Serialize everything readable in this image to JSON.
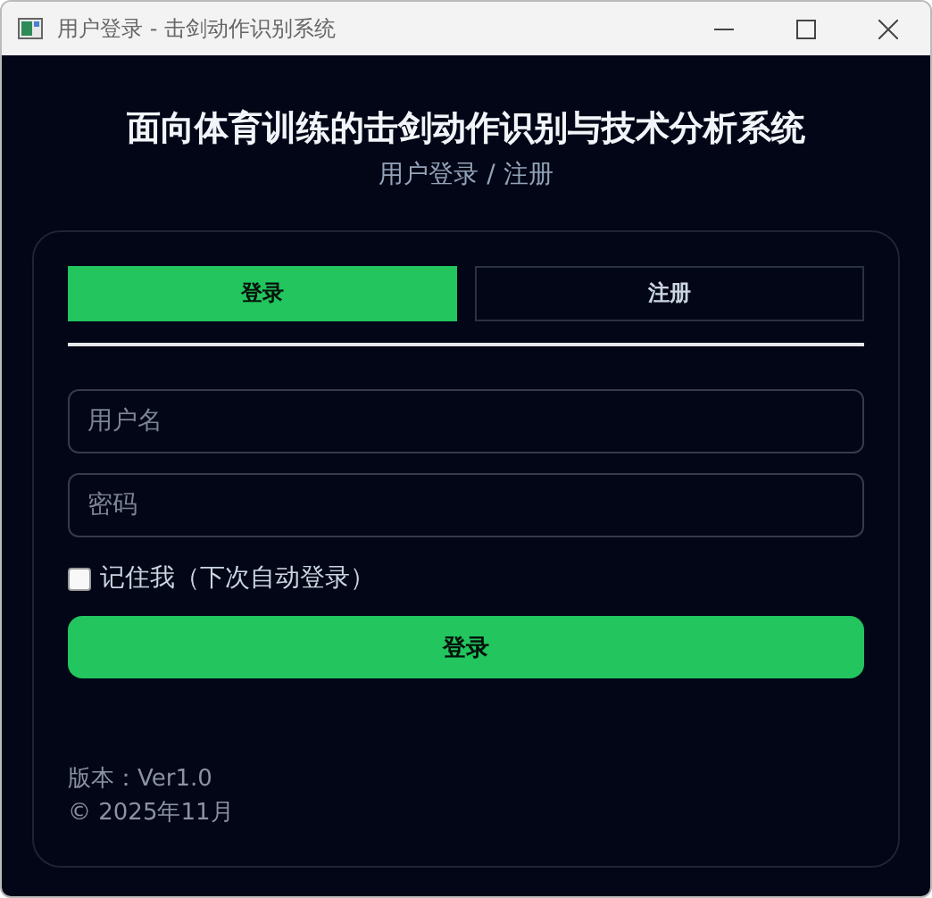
{
  "window": {
    "title": "用户登录 - 击剑动作识别系统"
  },
  "header": {
    "title": "面向体育训练的击剑动作识别与技术分析系统",
    "subtitle": "用户登录 / 注册"
  },
  "tabs": [
    {
      "label": "登录",
      "selected": true
    },
    {
      "label": "注册",
      "selected": false
    }
  ],
  "fields": [
    {
      "placeholder": "用户名"
    },
    {
      "placeholder": "密码"
    }
  ],
  "remember": {
    "label": "记住我（下次自动登录）",
    "checked": false
  },
  "submit": "登录",
  "footer": [
    "版本：Ver1.0",
    "© 2025年11月"
  ]
}
